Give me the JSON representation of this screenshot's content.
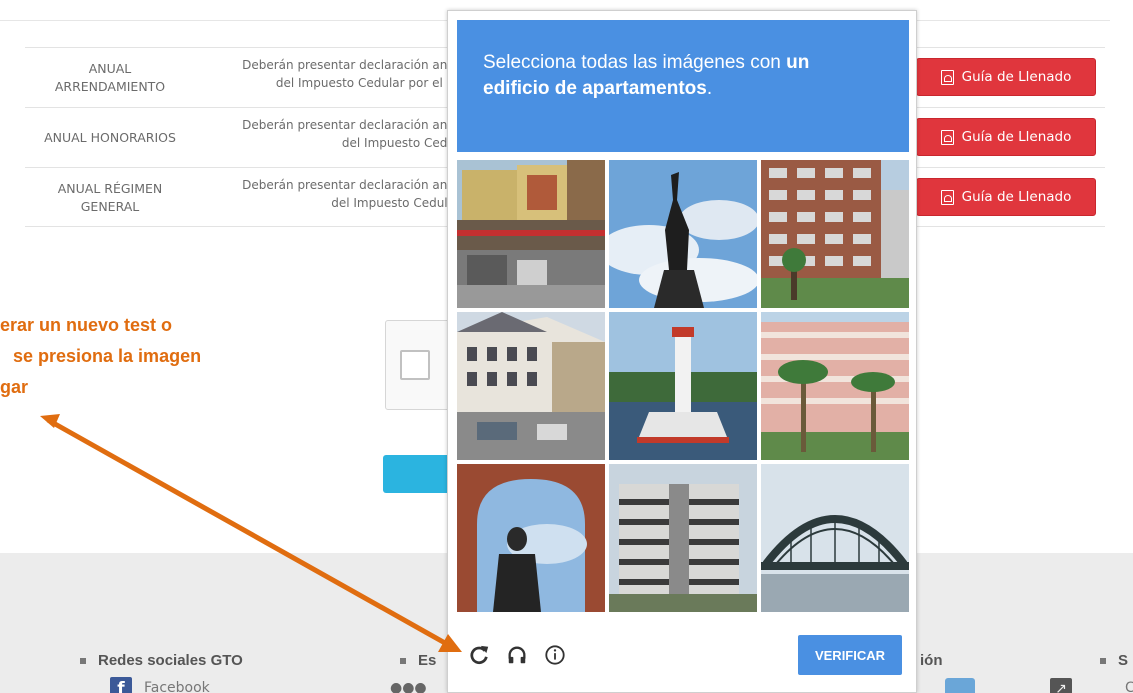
{
  "table": {
    "rows": [
      {
        "type": "ANUAL ARRENDAMIENTO",
        "type_lines": [
          "ANUAL",
          "ARRENDAMIENTO"
        ],
        "desc_lines": [
          "Deberán presentar declaración anu",
          "del Impuesto Cedular por el C"
        ],
        "button": "Guía de Llenado"
      },
      {
        "type": "ANUAL HONORARIOS",
        "type_lines": [
          "ANUAL HONORARIOS"
        ],
        "desc_lines": [
          "Deberán presentar declaración anu",
          "del Impuesto Cedu"
        ],
        "button": "Guía de Llenado"
      },
      {
        "type": "ANUAL RÉGIMEN GENERAL",
        "type_lines": [
          "ANUAL RÉGIMEN",
          "GENERAL"
        ],
        "desc_lines": [
          "Deberán presentar declaración anu",
          "del Impuesto Cedula"
        ],
        "button": "Guía de Llenado"
      }
    ]
  },
  "annotation": {
    "lines": [
      "erar un nuevo test o",
      "se presiona la imagen",
      "gar"
    ],
    "color": "#e06d10"
  },
  "captcha": {
    "instruction_prefix": "Selecciona todas las imágenes con ",
    "instruction_bold_1": "un",
    "instruction_bold_2": "edificio de apartamentos",
    "instruction_suffix": ".",
    "accent": "#4a90e2",
    "tiles": [
      "street-shops",
      "statue-sky",
      "apartment-block",
      "town-street",
      "lighthouse",
      "apartment-palms",
      "statue-arch",
      "round-building",
      "arch-bridge"
    ],
    "icons": [
      "reload-icon",
      "headphones-icon",
      "info-icon"
    ],
    "verify_label": "VERIFICAR"
  },
  "footer": {
    "redes_label": "Redes sociales GTO",
    "es_fragment": "Es",
    "ion_fragment": "ión",
    "s_fragment": "S",
    "facebook_label": "Facebook",
    "c_fragment": "C"
  }
}
